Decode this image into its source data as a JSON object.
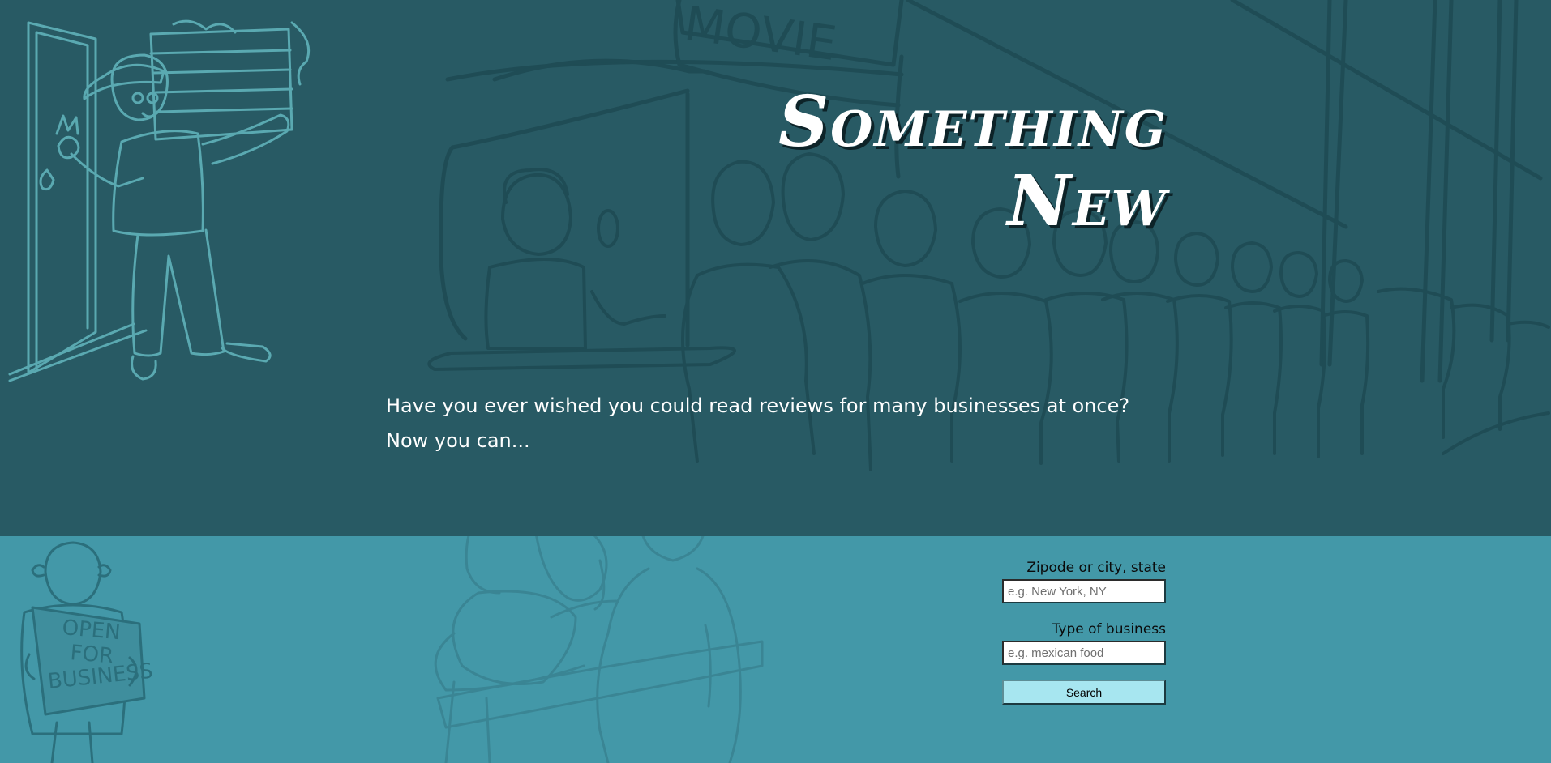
{
  "hero": {
    "title_line1": "Something",
    "title_line2": "New",
    "tagline_line1": "Have you ever wished you could read reviews for many businesses at once?",
    "tagline_line2": "Now you can...",
    "sign_text": "MOVIE"
  },
  "search_form": {
    "location_label": "Zipode or city, state",
    "location_placeholder": "e.g. New York, NY",
    "location_value": "",
    "business_label": "Type of business",
    "business_placeholder": "e.g. mexican food",
    "business_value": "",
    "search_label": "Search"
  },
  "lower": {
    "sign_line1": "OPEN",
    "sign_line2": "FOR",
    "sign_line3": "BUSINESS"
  },
  "colors": {
    "hero_bg": "#285a64",
    "lower_bg": "#4398a8",
    "button_bg": "#a7e6f0",
    "title_text": "#ffffff"
  },
  "icons": {
    "delivery": "pizza-delivery-illustration",
    "queue": "movie-queue-illustration",
    "shopkeeper": "open-for-business-illustration",
    "vet": "vet-dog-illustration"
  }
}
